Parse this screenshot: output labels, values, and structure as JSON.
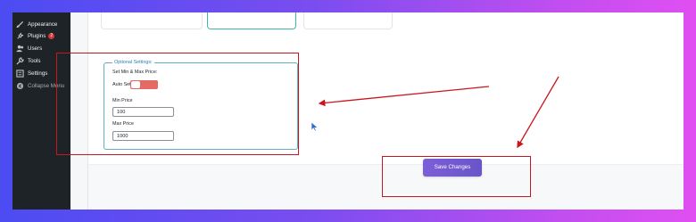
{
  "sidebar": {
    "items": [
      {
        "label": "Appearance",
        "icon": "paintbrush-icon"
      },
      {
        "label": "Plugins",
        "icon": "plug-icon",
        "badge": "2"
      },
      {
        "label": "Users",
        "icon": "users-icon"
      },
      {
        "label": "Tools",
        "icon": "wrench-icon"
      },
      {
        "label": "Settings",
        "icon": "settings-icon"
      },
      {
        "label": "Collapse Menu",
        "icon": "collapse-icon"
      }
    ]
  },
  "optional_settings": {
    "legend": "Optional Settings:",
    "heading": "Set Min & Max Price:",
    "auto_set_label": "Auto Set",
    "auto_set_toggle_color": "#e56a66",
    "min_price_label": "Min Price",
    "min_price_value": "100",
    "max_price_label": "Max Price",
    "max_price_value": "1000"
  },
  "footer": {
    "save_label": "Save Changes"
  },
  "colors": {
    "annotation_red": "#c9161d",
    "save_button": "#6a54c8",
    "sidebar_bg": "#1d2327"
  }
}
